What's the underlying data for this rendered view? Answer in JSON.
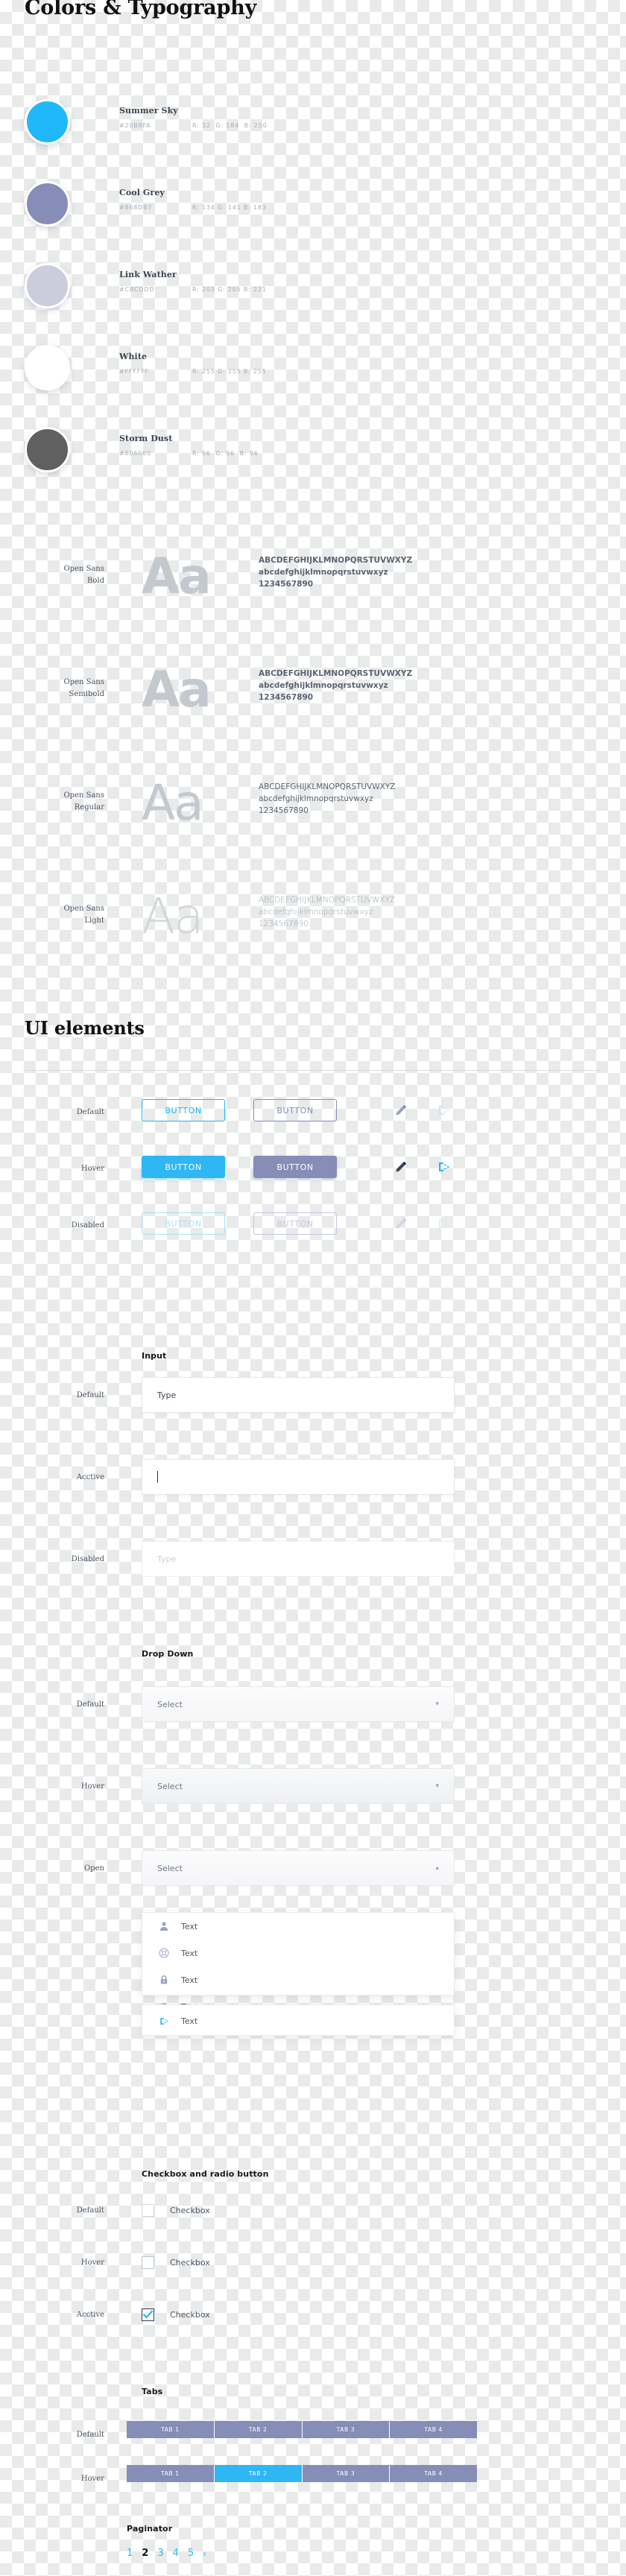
{
  "headings": {
    "colors": "Colors & Typography",
    "ui": "UI elements"
  },
  "colors": [
    {
      "name": "Summer Sky",
      "hex": "#20B8FA",
      "rgb": "R: 32  G: 184  B: 250",
      "swatch": "#20B8FA"
    },
    {
      "name": "Cool Grey",
      "hex": "#868DB7",
      "rgb": "R: 134 G: 141 B: 183",
      "swatch": "#868DB7"
    },
    {
      "name": "Link Wather",
      "hex": "#CBCDDD",
      "rgb": "R: 203 G: 205 B: 221",
      "swatch": "#CBCDDD"
    },
    {
      "name": "White",
      "hex": "#FFFFFF",
      "rgb": "R: 255 G: 255 B: 255",
      "swatch": "#FFFFFF"
    },
    {
      "name": "Storm Dust",
      "hex": "#606060",
      "rgb": "R: 96  G: 96  B: 96",
      "swatch": "#606060"
    }
  ],
  "typography": {
    "aa": "Aa",
    "uppercase": "ABCDEFGHIJKLMNOPQRSTUVWXYZ",
    "lowercase": "abcdefghijklmnopqrstuvwxyz",
    "digits": "1234567890",
    "rows": [
      {
        "family": "Open Sans",
        "weight": "Bold"
      },
      {
        "family": "Open Sans",
        "weight": "Semibold"
      },
      {
        "family": "Open Sans",
        "weight": "Regular"
      },
      {
        "family": "Open Sans",
        "weight": "Light"
      }
    ]
  },
  "states": {
    "default": "Default",
    "hover": "Hover",
    "disabled": "Disabled",
    "acctive": "Acctive",
    "active": "Active",
    "open": "Open"
  },
  "buttons": {
    "label": "BUTTON",
    "rows": [
      {
        "state": "Default"
      },
      {
        "state": "Hover"
      },
      {
        "state": "Disabled"
      }
    ],
    "icons": {
      "edit": "pencil-icon",
      "logout": "logout-icon"
    }
  },
  "input": {
    "title": "Input",
    "rows": [
      {
        "state": "Default",
        "value": "Type"
      },
      {
        "state": "Acctive",
        "value": ""
      },
      {
        "state": "Disabled",
        "value": "Type"
      }
    ]
  },
  "dropdown": {
    "title": "Drop Down",
    "rows": [
      {
        "state": "Default",
        "value": "Select",
        "chevron": "⌄"
      },
      {
        "state": "Hover",
        "value": "Select",
        "chevron": "⌄"
      },
      {
        "state": "Open",
        "value": "Select",
        "chevron": "⌃"
      }
    ],
    "menu_items": [
      {
        "icon": "user-icon",
        "label": "Text"
      },
      {
        "icon": "lifebuoy-icon",
        "label": "Text"
      },
      {
        "icon": "lock-icon",
        "label": "Text"
      },
      {
        "icon": "briefcase-icon",
        "label": "Text"
      }
    ],
    "menu_footer": {
      "icon": "logout-icon",
      "label": "Text"
    }
  },
  "checkbox": {
    "title": "Checkbox and radio button",
    "rows": [
      {
        "state": "Default",
        "label": "Checkbox",
        "checked": false
      },
      {
        "state": "Hover",
        "label": "Checkbox",
        "checked": false
      },
      {
        "state": "Acctive",
        "label": "Checkbox",
        "checked": true
      }
    ]
  },
  "tabs": {
    "title": "Tabs",
    "labels": [
      "TAB 1",
      "TAB 2",
      "TAB 3",
      "TAB 4"
    ],
    "rows": [
      {
        "state": "Default",
        "active_index": -1
      },
      {
        "state": "Hover",
        "active_index": 1
      }
    ]
  },
  "paginator": {
    "title": "Paginator",
    "pages": [
      "1",
      "2",
      "3",
      "4",
      "5"
    ],
    "current": "2",
    "next": "›"
  }
}
